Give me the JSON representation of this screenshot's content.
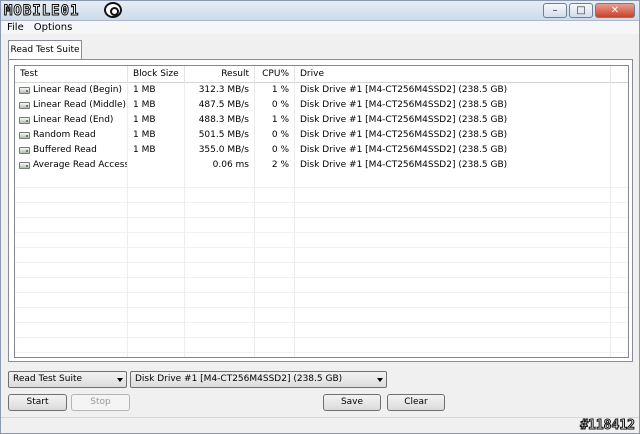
{
  "window": {
    "logo_text": "MOBILE01",
    "buttons": {
      "minimize": "–",
      "maximize": "□",
      "close": "✕"
    }
  },
  "menu": [
    "File",
    "Options"
  ],
  "tab": {
    "label": "Read Test Suite"
  },
  "table": {
    "headers": [
      "Test",
      "Block Size",
      "Result",
      "CPU%",
      "Drive"
    ],
    "rows": [
      {
        "test": "Linear Read (Begin)",
        "block": "1 MB",
        "result": "312.3 MB/s",
        "cpu": "1 %",
        "drive": "Disk Drive #1  [M4-CT256M4SSD2]  (238.5 GB)"
      },
      {
        "test": "Linear Read (Middle)",
        "block": "1 MB",
        "result": "487.5 MB/s",
        "cpu": "0 %",
        "drive": "Disk Drive #1  [M4-CT256M4SSD2]  (238.5 GB)"
      },
      {
        "test": "Linear Read (End)",
        "block": "1 MB",
        "result": "488.3 MB/s",
        "cpu": "1 %",
        "drive": "Disk Drive #1  [M4-CT256M4SSD2]  (238.5 GB)"
      },
      {
        "test": "Random Read",
        "block": "1 MB",
        "result": "501.5 MB/s",
        "cpu": "0 %",
        "drive": "Disk Drive #1  [M4-CT256M4SSD2]  (238.5 GB)"
      },
      {
        "test": "Buffered Read",
        "block": "1 MB",
        "result": "355.0 MB/s",
        "cpu": "0 %",
        "drive": "Disk Drive #1  [M4-CT256M4SSD2]  (238.5 GB)"
      },
      {
        "test": "Average Read Access",
        "block": "",
        "result": "0.06 ms",
        "cpu": "2 %",
        "drive": "Disk Drive #1  [M4-CT256M4SSD2]  (238.5 GB)"
      }
    ]
  },
  "controls": {
    "suite_select": "Read Test Suite",
    "drive_select": "Disk Drive #1  [M4-CT256M4SSD2]  (238.5 GB)",
    "start": "Start",
    "stop": "Stop",
    "save": "Save",
    "clear": "Clear"
  },
  "watermark": "#118412"
}
